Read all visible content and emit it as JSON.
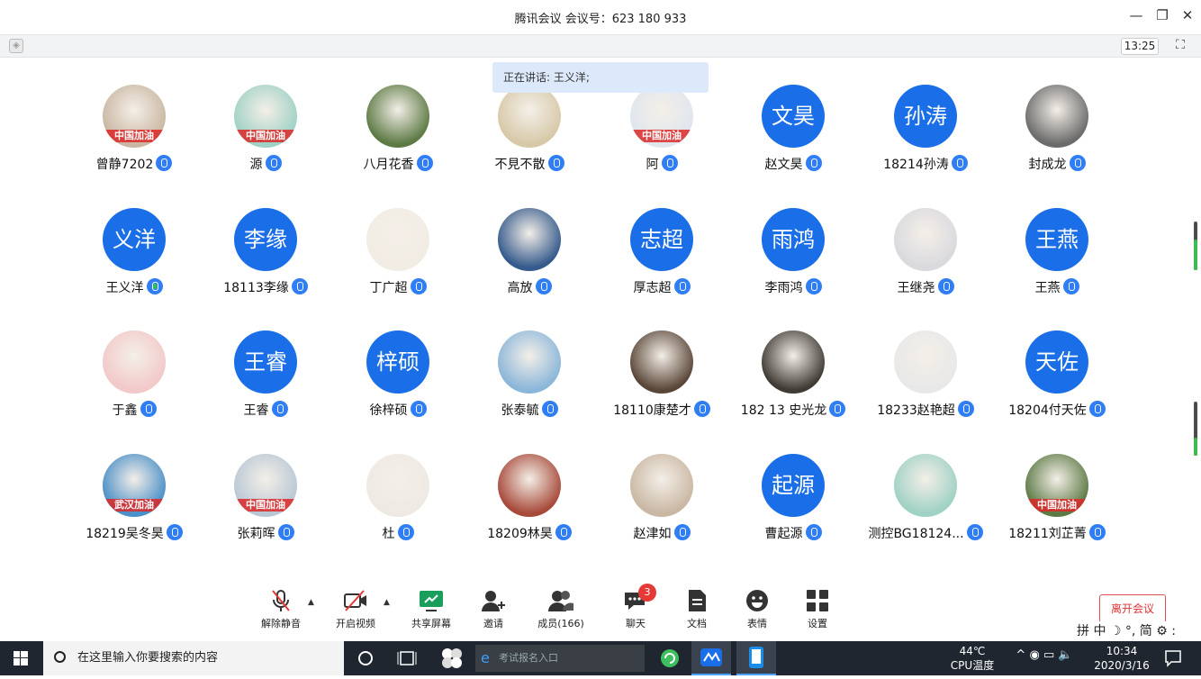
{
  "window": {
    "title": "腾讯会议 会议号：623 180 933",
    "minimize": "—",
    "restore": "❐",
    "close": "✕"
  },
  "toolbar": {
    "time": "13:25",
    "fullscreen_icon": "⛶"
  },
  "speaking_text": "正在讲话: 王义洋;",
  "participants": [
    {
      "name": "曾静7202",
      "avatar": "photo",
      "banner": "中国加油"
    },
    {
      "name": "源",
      "avatar": "photo",
      "banner": "中国加油"
    },
    {
      "name": "八月花香",
      "avatar": "photo",
      "banner": ""
    },
    {
      "name": "不見不散",
      "avatar": "photo",
      "banner": ""
    },
    {
      "name": "阿",
      "avatar": "photo",
      "banner": "中国加油"
    },
    {
      "name": "赵文昊",
      "avatar_text": "文昊"
    },
    {
      "name": "18214孙涛",
      "avatar_text": "孙涛"
    },
    {
      "name": "封成龙",
      "avatar": "photo",
      "banner": ""
    },
    {
      "name": "王义洋",
      "avatar_text": "义洋",
      "speaking": true
    },
    {
      "name": "18113李缘",
      "avatar_text": "李缘"
    },
    {
      "name": "丁广超",
      "avatar": "photo",
      "banner": ""
    },
    {
      "name": "高放",
      "avatar": "photo",
      "banner": ""
    },
    {
      "name": "厚志超",
      "avatar_text": "志超"
    },
    {
      "name": "李雨鸿",
      "avatar_text": "雨鸿"
    },
    {
      "name": "王继尧",
      "avatar": "photo",
      "banner": ""
    },
    {
      "name": "王燕",
      "avatar_text": "王燕"
    },
    {
      "name": "于鑫",
      "avatar": "photo",
      "banner": ""
    },
    {
      "name": "王睿",
      "avatar_text": "王睿"
    },
    {
      "name": "徐梓硕",
      "avatar_text": "梓硕"
    },
    {
      "name": "张泰毓",
      "avatar": "photo",
      "banner": ""
    },
    {
      "name": "18110康楚才",
      "avatar": "photo",
      "banner": ""
    },
    {
      "name": "182 13 史光龙",
      "avatar": "photo",
      "banner": ""
    },
    {
      "name": "18233赵艳超",
      "avatar": "photo",
      "banner": ""
    },
    {
      "name": "18204付天佐",
      "avatar_text": "天佐"
    },
    {
      "name": "18219吴冬昊",
      "avatar": "photo",
      "banner": "武汉加油"
    },
    {
      "name": "张莉晖",
      "avatar": "photo",
      "banner": "中国加油"
    },
    {
      "name": "杜",
      "avatar": "photo",
      "banner": ""
    },
    {
      "name": "18209林昊",
      "avatar": "photo",
      "banner": ""
    },
    {
      "name": "赵津如",
      "avatar": "photo",
      "banner": ""
    },
    {
      "name": "曹起源",
      "avatar_text": "起源"
    },
    {
      "name": "测控BG18124...",
      "avatar": "photo",
      "banner": ""
    },
    {
      "name": "18211刘芷菁",
      "avatar": "photo",
      "banner": "中国加油"
    }
  ],
  "bottom_toolbar": {
    "unmute": "解除静音",
    "start_video": "开启视频",
    "share_screen": "共享屏幕",
    "invite": "邀请",
    "members": "成员(166)",
    "chat": "聊天",
    "chat_badge": "3",
    "docs": "文档",
    "emoji": "表情",
    "settings": "设置",
    "leave": "离开会议"
  },
  "ime_bar": "拼 中 ☽ °, 简 ⚙ :",
  "taskbar": {
    "search_placeholder": "在这里输入你要搜索的内容",
    "browser_text": "考试报名入口",
    "temp": "44℃",
    "temp_label": "CPU温度",
    "time": "10:34",
    "date": "2020/3/16"
  },
  "colors": {
    "avatar_blue": "#1a6ee8",
    "accent_green": "#3dbb4e",
    "leave_red": "#e03030",
    "taskbar": "#1f2630"
  }
}
